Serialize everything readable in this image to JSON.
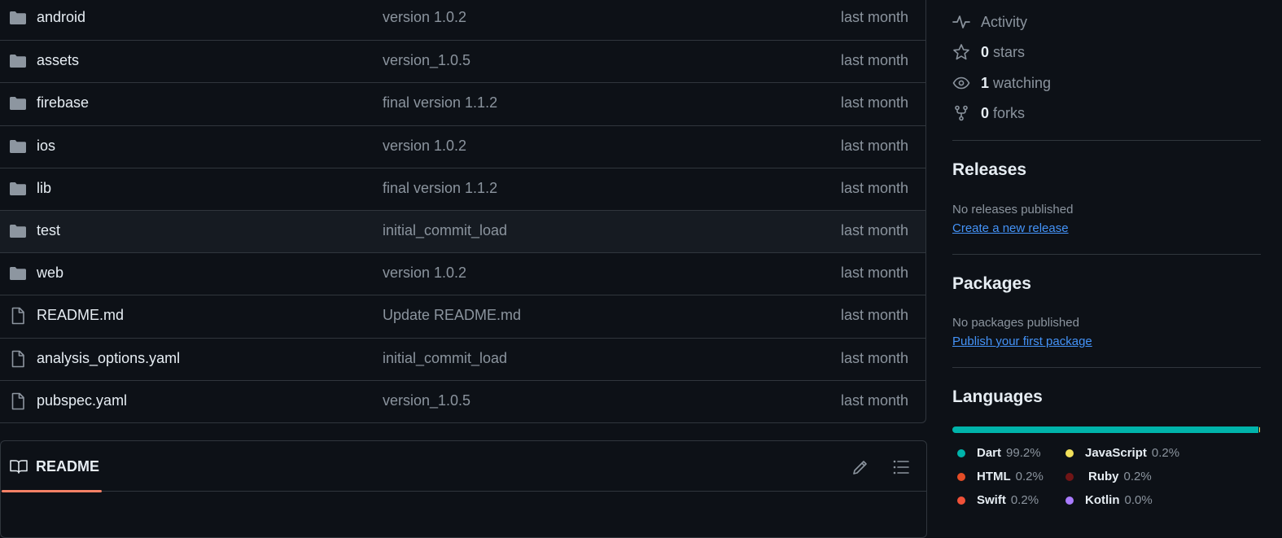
{
  "files": [
    {
      "name": "android",
      "type": "folder",
      "message": "version 1.0.2",
      "date": "last month"
    },
    {
      "name": "assets",
      "type": "folder",
      "message": "version_1.0.5",
      "date": "last month"
    },
    {
      "name": "firebase",
      "type": "folder",
      "message": "final version 1.1.2",
      "date": "last month"
    },
    {
      "name": "ios",
      "type": "folder",
      "message": "version 1.0.2",
      "date": "last month"
    },
    {
      "name": "lib",
      "type": "folder",
      "message": "final version 1.1.2",
      "date": "last month"
    },
    {
      "name": "test",
      "type": "folder",
      "message": "initial_commit_load",
      "date": "last month"
    },
    {
      "name": "web",
      "type": "folder",
      "message": "version 1.0.2",
      "date": "last month"
    },
    {
      "name": "README.md",
      "type": "file",
      "message": "Update README.md",
      "date": "last month"
    },
    {
      "name": "analysis_options.yaml",
      "type": "file",
      "message": "initial_commit_load",
      "date": "last month"
    },
    {
      "name": "pubspec.yaml",
      "type": "file",
      "message": "version_1.0.5",
      "date": "last month"
    }
  ],
  "readme": {
    "tab_label": "README"
  },
  "sidebar": {
    "activity_label": "Activity",
    "stars": {
      "count": "0",
      "label": "stars"
    },
    "watching": {
      "count": "1",
      "label": "watching"
    },
    "forks": {
      "count": "0",
      "label": "forks"
    },
    "releases": {
      "title": "Releases",
      "empty": "No releases published",
      "link": "Create a new release"
    },
    "packages": {
      "title": "Packages",
      "empty": "No packages published",
      "link": "Publish your first package"
    },
    "languages": {
      "title": "Languages",
      "items": [
        {
          "name": "Dart",
          "percent": "99.2%",
          "value": 99.2,
          "color": "#00b4ab"
        },
        {
          "name": "JavaScript",
          "percent": "0.2%",
          "value": 0.2,
          "color": "#f1e05a"
        },
        {
          "name": "HTML",
          "percent": "0.2%",
          "value": 0.2,
          "color": "#e34c26"
        },
        {
          "name": "Ruby",
          "percent": "0.2%",
          "value": 0.2,
          "color": "#701516"
        },
        {
          "name": "Swift",
          "percent": "0.2%",
          "value": 0.2,
          "color": "#f05138"
        },
        {
          "name": "Kotlin",
          "percent": "0.0%",
          "value": 0.0,
          "color": "#a97bff"
        }
      ]
    }
  },
  "colors": {
    "accent": "#4493f8",
    "tab_underline": "#f78166"
  }
}
